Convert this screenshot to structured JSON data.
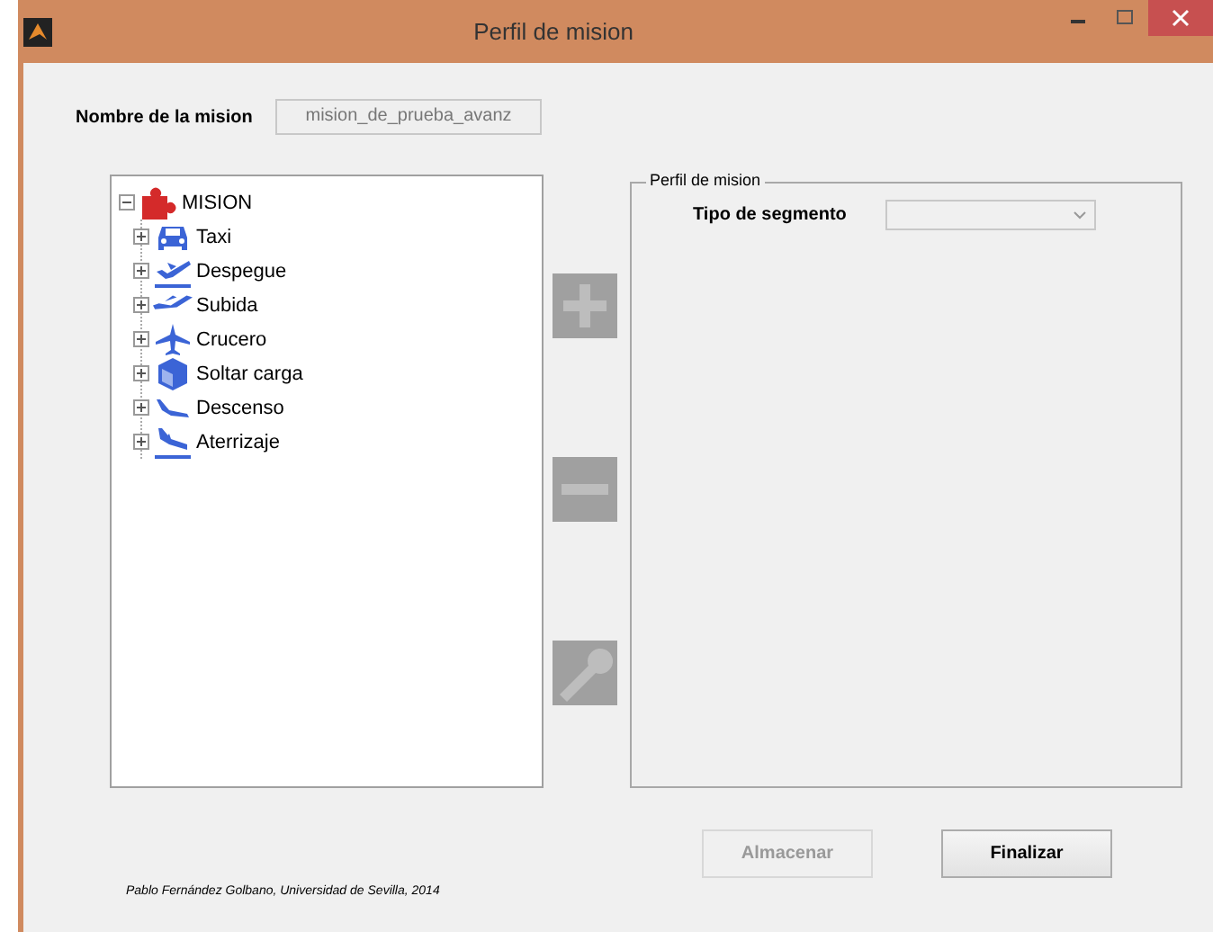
{
  "window": {
    "title": "Perfil de mision"
  },
  "mission_name": {
    "label": "Nombre de la mision",
    "value": "mision_de_prueba_avanz",
    "disabled": true
  },
  "tree": {
    "label": "MISION",
    "expanded": true,
    "children": [
      {
        "label": "Taxi",
        "kind": "taxi",
        "expanded": false
      },
      {
        "label": "Despegue",
        "kind": "takeoff",
        "expanded": false
      },
      {
        "label": "Subida",
        "kind": "climb",
        "expanded": false
      },
      {
        "label": "Crucero",
        "kind": "cruise",
        "expanded": false
      },
      {
        "label": "Soltar carga",
        "kind": "drop",
        "expanded": false
      },
      {
        "label": "Descenso",
        "kind": "descent",
        "expanded": false
      },
      {
        "label": "Aterrizaje",
        "kind": "landing",
        "expanded": false
      }
    ]
  },
  "side_buttons": [
    {
      "kind": "add",
      "disabled": true
    },
    {
      "kind": "remove",
      "disabled": true
    },
    {
      "kind": "edit",
      "disabled": true
    }
  ],
  "profile_panel": {
    "title": "Perfil de mision",
    "segment_label": "Tipo de segmento",
    "segment_disabled": true
  },
  "buttons": [
    {
      "label": "Almacenar",
      "disabled": true
    },
    {
      "label": "Finalizar",
      "disabled": false
    }
  ],
  "footer": "Pablo Fernández Golbano, Universidad de Sevilla, 2014"
}
